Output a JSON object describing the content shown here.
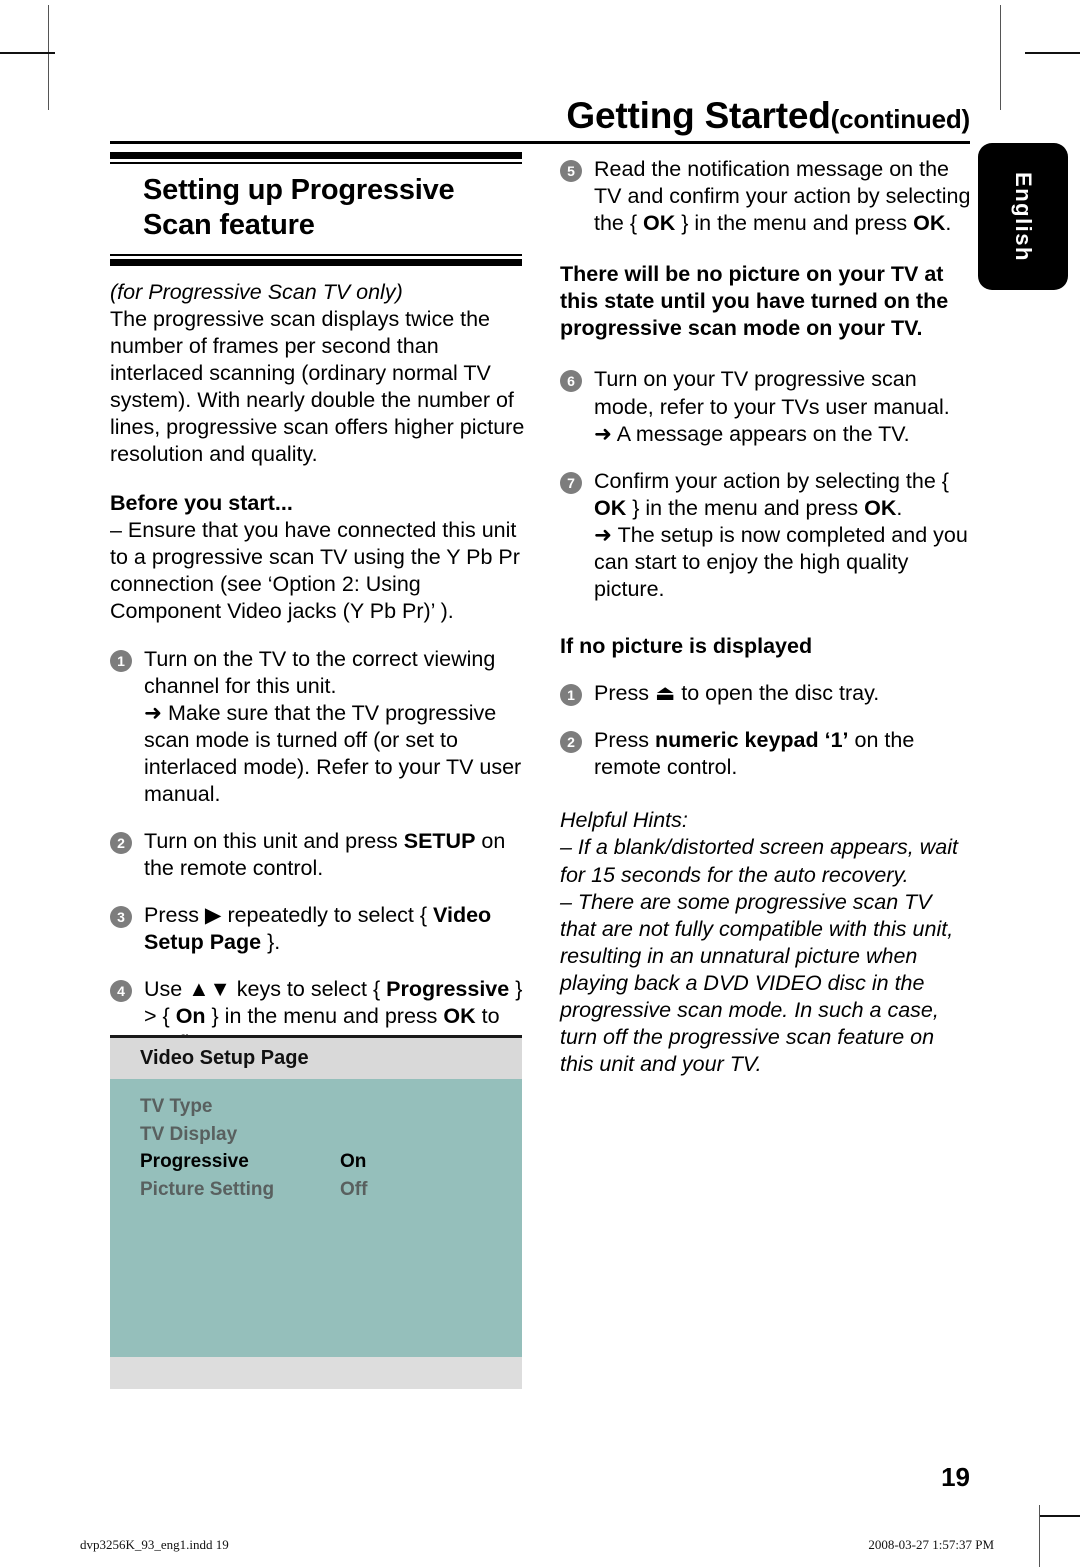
{
  "header": {
    "title": "Getting Started",
    "continued": "(continued)"
  },
  "language_tab": {
    "label": "English"
  },
  "left_column": {
    "section_title": "Setting up Progressive Scan feature",
    "subtitle_italic": "(for Progressive Scan TV only)",
    "intro_paragraph": "The progressive scan displays twice the number of frames per second than interlaced scanning (ordinary normal TV system). With nearly double the number of lines, progressive scan offers higher picture resolution and quality.",
    "before_you_start_heading": "Before you start...",
    "before_you_start_item": "–  Ensure that you have connected this unit to a progressive scan TV using the Y Pb Pr connection (see ‘Option 2: Using Component Video jacks (Y Pb Pr)’ ).",
    "steps": [
      {
        "num": "1",
        "text": "Turn on the TV to the correct viewing channel for this unit.",
        "arrow_text": "➜ Make sure that the TV progressive scan mode is turned off (or set to interlaced mode). Refer to your TV user manual."
      },
      {
        "num": "2",
        "text_pre": "Turn on this unit and press ",
        "text_bold": "SETUP",
        "text_post": " on the remote control."
      },
      {
        "num": "3",
        "text_pre": "Press ▶ repeatedly to select { ",
        "text_bold": "Video Setup Page",
        "text_post": " }."
      },
      {
        "num": "4",
        "text_pre": "Use ▲▼ keys to select { ",
        "text_bold": "Progressive",
        "text_mid": " } > { ",
        "text_bold2": "On",
        "text_mid2": " } in the menu and press ",
        "text_bold3": "OK",
        "text_post": " to confirm."
      }
    ]
  },
  "osd_menu": {
    "header": "Video Setup Page",
    "rows": [
      {
        "label": "TV Type",
        "value": "",
        "state": "dim"
      },
      {
        "label": "TV Display",
        "value": "",
        "state": "dim"
      },
      {
        "label": "Progressive",
        "value": "On",
        "state": "active"
      },
      {
        "label": "Picture Setting",
        "value": "Off",
        "state": "dim"
      }
    ],
    "colors": {
      "header_bg": "#d9d9d9",
      "body_bg": "#95bfbb",
      "footer_bg": "#dddddd",
      "dim_text": "#59605f",
      "active_text": "#000000"
    }
  },
  "right_column": {
    "steps": [
      {
        "num": "5",
        "text_pre": "Read the notification message on the TV and confirm your action by selecting the { ",
        "text_bold": "OK",
        "text_post": " } in the menu and press ",
        "text_bold2": "OK",
        "text_end": "."
      },
      {
        "num": "6",
        "text": "Turn on your TV progressive scan mode, refer to your TVs user manual.",
        "arrow_text": "➜ A message appears on the TV."
      },
      {
        "num": "7",
        "text_pre": "Confirm your action by selecting the { ",
        "text_bold": "OK",
        "text_post": " } in the menu and press ",
        "text_bold2": "OK",
        "text_end": ".",
        "arrow_text": "➜ The setup is now completed and you can start to enjoy the high quality picture."
      }
    ],
    "warning_bold": "There will be no picture on your TV at this state until you have turned on the progressive scan mode on your TV.",
    "no_picture_heading": "If no picture is displayed",
    "no_picture_steps": [
      {
        "num": "1",
        "text_pre": "Press ",
        "icon": "eject-icon",
        "text_post": " to open the disc tray."
      },
      {
        "num": "2",
        "text_pre": "Press ",
        "text_bold": "numeric keypad ‘1’",
        "text_post": " on the remote control."
      }
    ],
    "helpful_hints_heading": "Helpful Hints:",
    "helpful_hints": [
      "–  If a blank/distorted screen appears, wait for 15 seconds for the auto recovery.",
      "–  There are some progressive scan TV that are not fully compatible with this unit, resulting in an unnatural picture when playing back a DVD VIDEO disc in the progressive scan mode. In such a case, turn off the progressive scan feature on this unit and your TV."
    ]
  },
  "footer": {
    "page_number": "19",
    "file_name": "dvp3256K_93_eng1.indd   19",
    "timestamp": "2008-03-27   1:57:37 PM"
  }
}
